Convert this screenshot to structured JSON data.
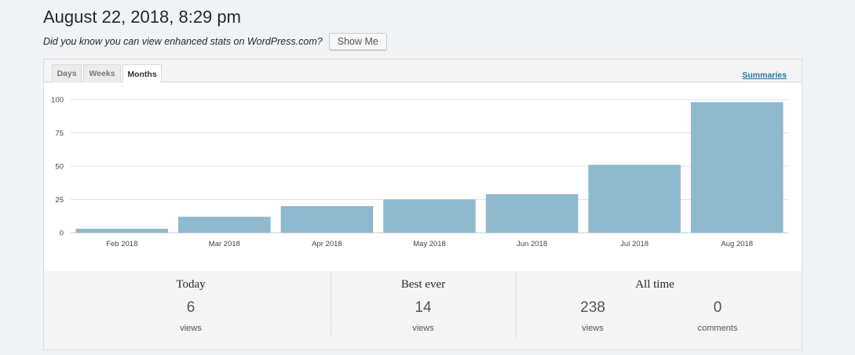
{
  "header": {
    "title": "August 22, 2018, 8:29 pm",
    "hint": "Did you know you can view enhanced stats on WordPress.com?",
    "show_me_label": "Show Me"
  },
  "tabs": [
    {
      "label": "Days",
      "active": false
    },
    {
      "label": "Weeks",
      "active": false
    },
    {
      "label": "Months",
      "active": true
    }
  ],
  "summaries_link": "Summaries",
  "chart_data": {
    "type": "bar",
    "categories": [
      "Feb 2018",
      "Mar 2018",
      "Apr 2018",
      "May 2018",
      "Jun 2018",
      "Jul 2018",
      "Aug 2018"
    ],
    "values": [
      3,
      12,
      20,
      25,
      29,
      51,
      98
    ],
    "yticks": [
      "0",
      "25",
      "50",
      "75",
      "100"
    ],
    "ylim": [
      0,
      100
    ],
    "bar_color": "#8fb9cd",
    "grid": true
  },
  "summary": {
    "today": {
      "label": "Today",
      "value": "6",
      "unit": "views"
    },
    "best_ever": {
      "label": "Best ever",
      "value": "14",
      "unit": "views"
    },
    "all_time": {
      "label": "All time",
      "views_value": "238",
      "views_unit": "views",
      "comments_value": "0",
      "comments_unit": "comments"
    }
  }
}
